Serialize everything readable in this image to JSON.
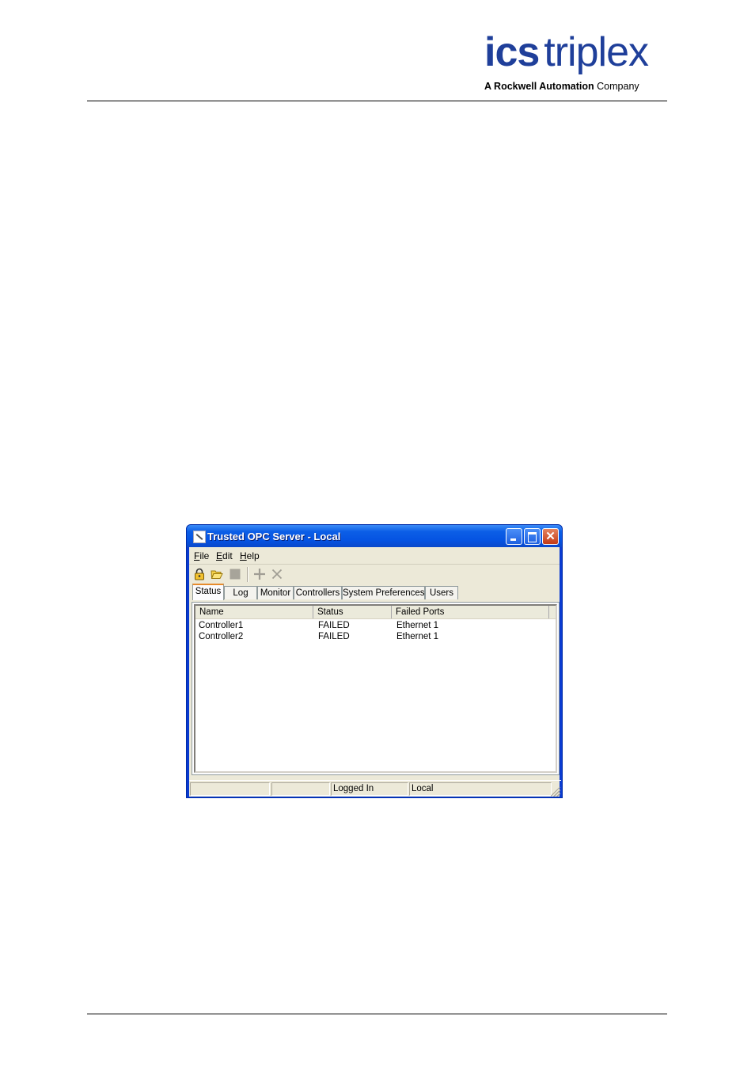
{
  "header": {
    "logo_primary": "ics",
    "logo_secondary": "triplex",
    "tagline_lead": "A Rockwell Automation",
    "tagline_tail": "Company"
  },
  "window": {
    "title": "Trusted OPC Server - Local",
    "close_glyph": "✕"
  },
  "menu": {
    "file_hot": "F",
    "file_rest": "ile",
    "edit_hot": "E",
    "edit_rest": "dit",
    "help_hot": "H",
    "help_rest": "elp"
  },
  "toolbar": {
    "icons": [
      "lock-icon",
      "folder-open-icon",
      "stop-icon",
      "add-icon",
      "remove-icon"
    ]
  },
  "tabs": [
    "Status",
    "Log",
    "Monitor",
    "Controllers",
    "System Preferences",
    "Users"
  ],
  "list": {
    "columns": [
      "Name",
      "Status",
      "Failed Ports"
    ],
    "rows": [
      {
        "name": "Controller1",
        "status": "FAILED",
        "ports": "Ethernet 1"
      },
      {
        "name": "Controller2",
        "status": "FAILED",
        "ports": "Ethernet 1"
      }
    ]
  },
  "statusbar": {
    "pane1": "",
    "pane2": "",
    "pane3": "Logged In",
    "pane4": "Local"
  },
  "colors": {
    "titlebar": "#0553e2",
    "window_face": "#ece9d8",
    "logo_blue": "#1f3f9a",
    "tab_highlight": "#e68b2c"
  }
}
